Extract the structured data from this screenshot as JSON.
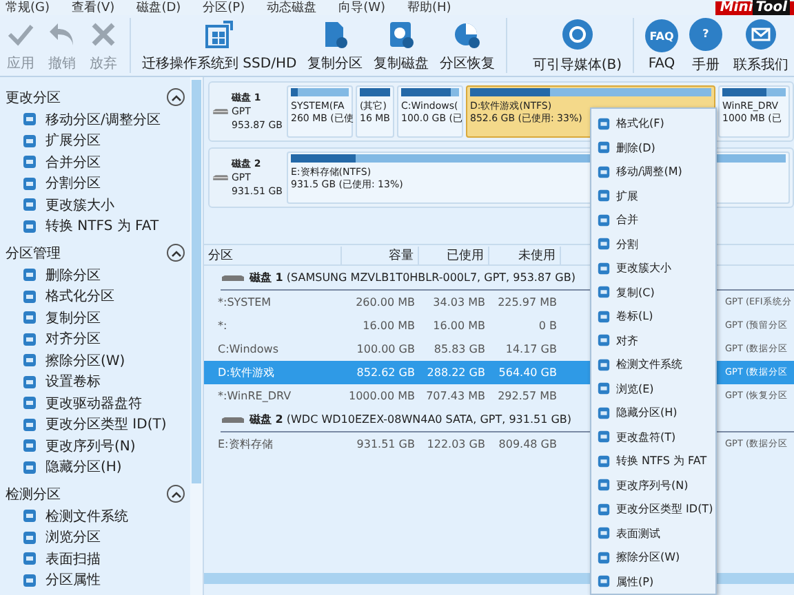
{
  "menu_bar": [
    "常规(G)",
    "查看(V)",
    "磁盘(D)",
    "分区(P)",
    "动态磁盘",
    "向导(W)",
    "帮助(H)"
  ],
  "logo": {
    "part1": "Mini",
    "part2": "Tool"
  },
  "toolbar": [
    {
      "label": "应用",
      "kind": "check",
      "disabled": true
    },
    {
      "label": "撤销",
      "kind": "undo",
      "disabled": true
    },
    {
      "label": "放弃",
      "kind": "cross",
      "disabled": true
    },
    {
      "label": "迁移操作系统到 SSD/HD",
      "kind": "migrate",
      "disabled": false
    },
    {
      "label": "复制分区",
      "kind": "copy",
      "disabled": false
    },
    {
      "label": "复制磁盘",
      "kind": "disk",
      "disabled": false
    },
    {
      "label": "分区恢复",
      "kind": "recover",
      "disabled": false
    },
    {
      "label": "可引导媒体(B)",
      "kind": "media",
      "disabled": false
    },
    {
      "label": "FAQ",
      "kind": "circle",
      "icon_text": "FAQ",
      "disabled": false
    },
    {
      "label": "手册",
      "kind": "circle",
      "icon_text": "?",
      "disabled": false
    },
    {
      "label": "联系我们",
      "kind": "mail",
      "disabled": false
    }
  ],
  "sidebar": {
    "sections": [
      {
        "title": "更改分区",
        "expanded": true,
        "items": [
          "移动分区/调整分区",
          "扩展分区",
          "合并分区",
          "分割分区",
          "更改簇大小",
          "转换 NTFS 为 FAT"
        ]
      },
      {
        "title": "分区管理",
        "expanded": true,
        "items": [
          "删除分区",
          "格式化分区",
          "复制分区",
          "对齐分区",
          "擦除分区(W)",
          "设置卷标",
          "更改驱动器盘符",
          "更改分区类型 ID(T)",
          "更改序列号(N)",
          "隐藏分区(H)"
        ]
      },
      {
        "title": "检测分区",
        "expanded": true,
        "items": [
          "检测文件系统",
          "浏览分区",
          "表面扫描",
          "分区属性"
        ]
      }
    ]
  },
  "disk_map": [
    {
      "name": "磁盘 1",
      "type": "GPT",
      "size": "953.87 GB",
      "partitions": [
        {
          "name": "SYSTEM(FA",
          "info": "260 MB (已使",
          "level": 0.13,
          "selected": false
        },
        {
          "name": "(其它)",
          "info": "16 MB",
          "level": 1,
          "selected": false
        },
        {
          "name": "C:Windows(",
          "info": "100.0 GB (已",
          "level": 0.86,
          "selected": false
        },
        {
          "name": "D:软件游戏(NTFS)",
          "info": "852.6 GB (已使用: 33%)",
          "level": 0.33,
          "selected": true
        },
        {
          "name": "WinRE_DRV",
          "info": "1000 MB (已",
          "level": 0.7,
          "selected": false
        }
      ]
    },
    {
      "name": "磁盘 2",
      "type": "GPT",
      "size": "931.51 GB",
      "partitions": [
        {
          "name": "E:资料存储(NTFS)",
          "info": "931.5 GB (已使用: 13%)",
          "level": 0.13,
          "selected": false
        }
      ]
    }
  ],
  "table": {
    "columns": [
      "分区",
      "容量",
      "已使用",
      "未使用"
    ],
    "rows": [
      {
        "kind": "disk",
        "label": "**磁盘 1** (SAMSUNG MZVLB1T0HBLR-000L7, GPT, 953.87 GB)"
      },
      {
        "kind": "partition",
        "cells": [
          "*:SYSTEM",
          "260.00 MB",
          "34.03 MB",
          "225.97 MB"
        ],
        "column_5": "GPT (EFI系统分",
        "selected": false
      },
      {
        "kind": "partition",
        "cells": [
          "*:",
          "16.00 MB",
          "16.00 MB",
          "0 B"
        ],
        "column_5": "GPT (预留分区",
        "selected": false
      },
      {
        "kind": "partition",
        "cells": [
          "C:Windows",
          "100.00 GB",
          "85.83 GB",
          "14.17 GB"
        ],
        "column_5": "GPT (数据分区",
        "selected": false
      },
      {
        "kind": "partition",
        "cells": [
          "D:软件游戏",
          "852.62 GB",
          "288.22 GB",
          "564.40 GB"
        ],
        "column_5": "GPT (数据分区",
        "selected": true
      },
      {
        "kind": "partition",
        "cells": [
          "*:WinRE_DRV",
          "1000.00 MB",
          "707.43 MB",
          "292.57 MB"
        ],
        "column_5": "GPT (恢复分区",
        "selected": false
      },
      {
        "kind": "disk",
        "label": "**磁盘 2** (WDC WD10EZEX-08WN4A0 SATA, GPT, 931.51 GB)"
      },
      {
        "kind": "partition",
        "cells": [
          "E:资料存储",
          "931.51 GB",
          "122.03 GB",
          "809.48 GB"
        ],
        "column_5": "GPT (数据分区",
        "selected": false
      }
    ]
  },
  "context_menu": [
    "格式化(F)",
    "删除(D)",
    "移动/调整(M)",
    "扩展",
    "合并",
    "分割",
    "更改簇大小",
    "复制(C)",
    "卷标(L)",
    "对齐",
    "检测文件系统",
    "浏览(E)",
    "隐藏分区(H)",
    "更改盘符(T)",
    "转换 NTFS 为 FAT",
    "更改序列号(N)",
    "更改分区类型 ID(T)",
    "表面测试",
    "擦除分区(W)",
    "属性(P)"
  ]
}
